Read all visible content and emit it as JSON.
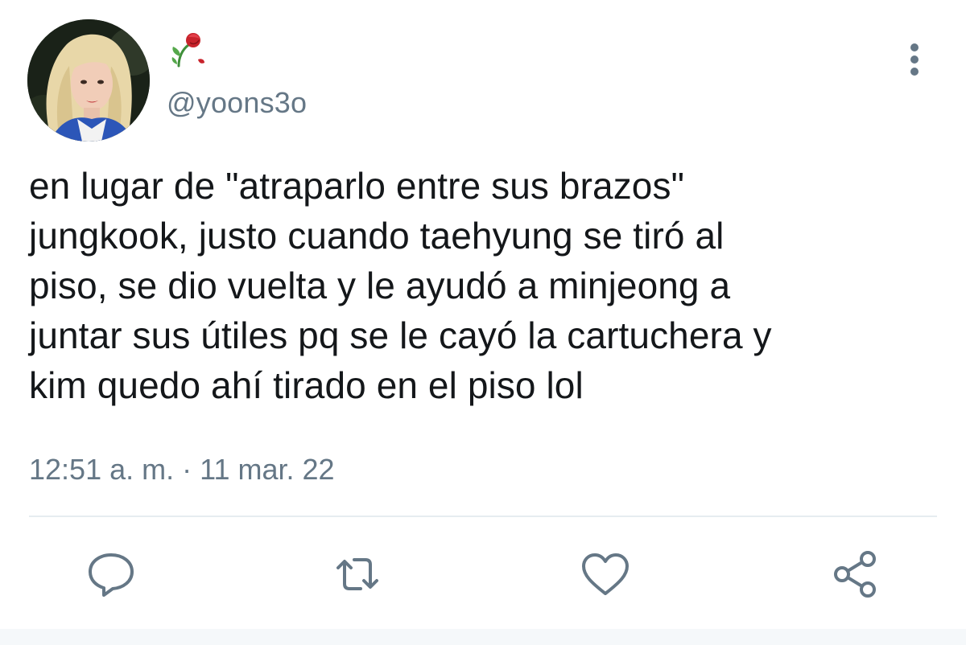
{
  "user": {
    "handle": "@yoons3o",
    "display_name_icon": "wilted-rose-emoji"
  },
  "tweet": {
    "text": "en lugar de \"atraparlo entre sus brazos\"\njungkook, justo cuando taehyung se tiró al\npiso, se dio vuelta y le ayudó a minjeong a\njuntar sus útiles pq se le cayó la cartuchera y\nkim quedo ahí tirado en el piso lol",
    "timestamp": "12:51 a. m. · 11 mar. 22"
  },
  "actions": {
    "reply_icon": "reply-icon",
    "retweet_icon": "retweet-icon",
    "like_icon": "like-icon",
    "share_icon": "share-icon"
  },
  "colors": {
    "text": "#14171a",
    "secondary": "#657786",
    "divider": "#e6ecf0"
  }
}
